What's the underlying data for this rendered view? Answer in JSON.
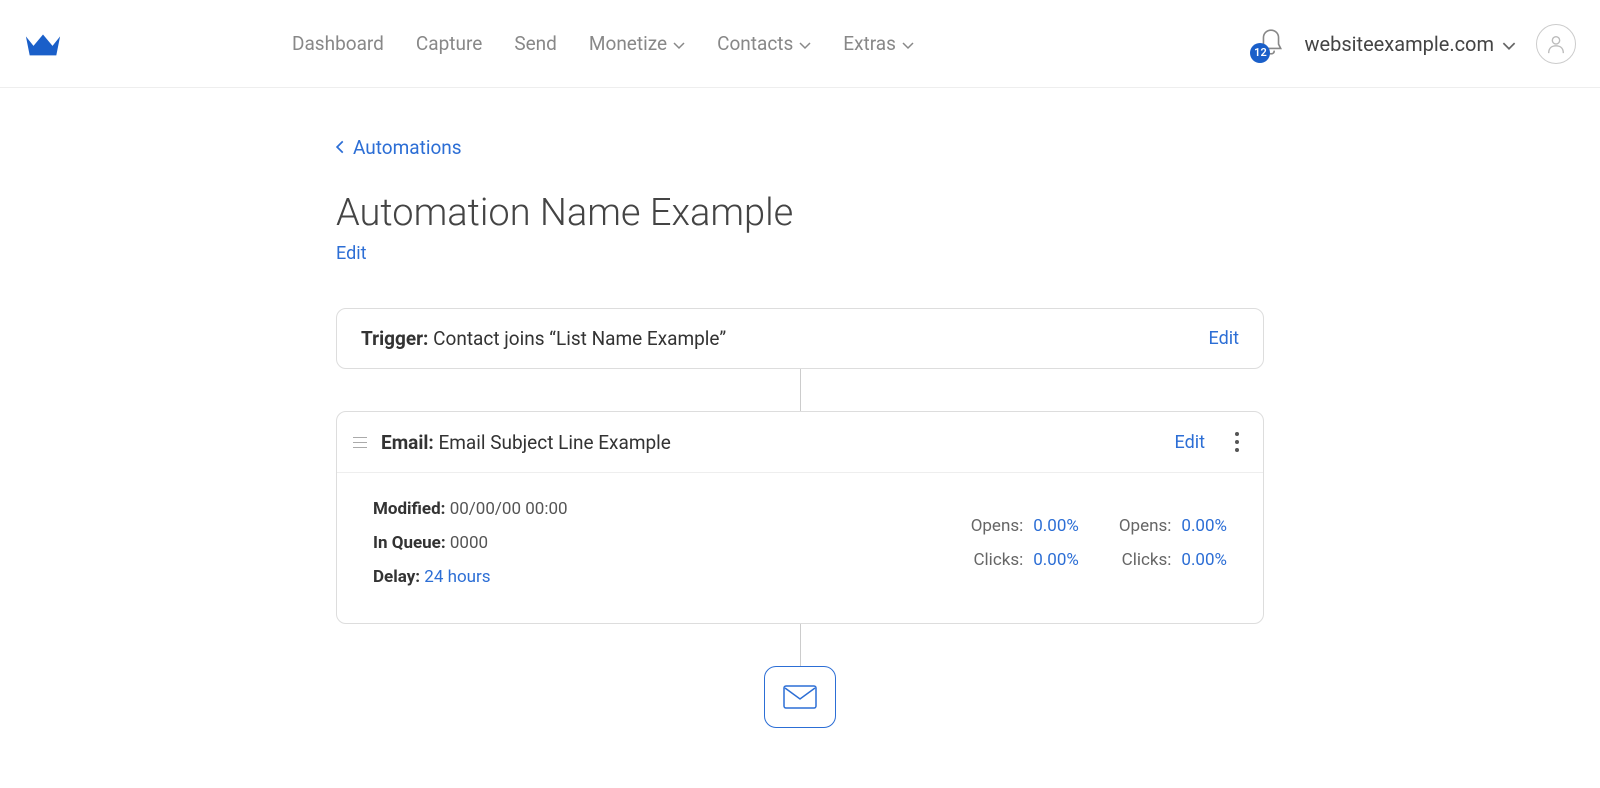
{
  "nav": {
    "items": [
      "Dashboard",
      "Capture",
      "Send",
      "Monetize",
      "Contacts",
      "Extras"
    ]
  },
  "header": {
    "notification_count": "12",
    "domain": "websiteexample.com"
  },
  "breadcrumb": {
    "label": "Automations"
  },
  "page": {
    "title": "Automation Name Example",
    "edit_label": "Edit"
  },
  "trigger": {
    "label_prefix": "Trigger:",
    "text": "Contact joins “List Name Example”",
    "edit_label": "Edit"
  },
  "email_step": {
    "label_prefix": "Email:",
    "subject": "Email Subject Line Example",
    "edit_label": "Edit",
    "meta": {
      "modified_label": "Modified:",
      "modified_value": "00/00/00 00:00",
      "queue_label": "In Queue:",
      "queue_value": "0000",
      "delay_label": "Delay:",
      "delay_value": "24 hours"
    },
    "stats": {
      "col1": {
        "opens_label": "Opens:",
        "opens_value": "0.00%",
        "clicks_label": "Clicks:",
        "clicks_value": "0.00%"
      },
      "col2": {
        "opens_label": "Opens:",
        "opens_value": "0.00%",
        "clicks_label": "Clicks:",
        "clicks_value": "0.00%"
      }
    }
  }
}
